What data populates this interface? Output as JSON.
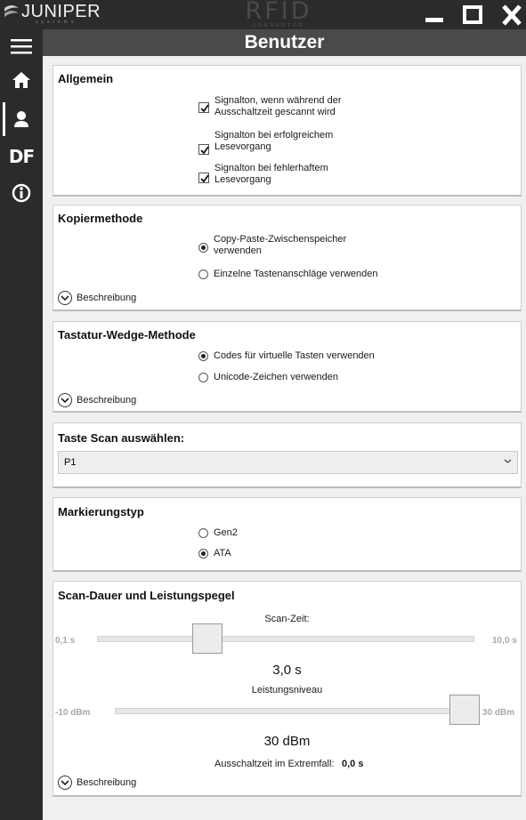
{
  "titlebar": {
    "brand": "JUNIPER",
    "brand_sub": "systems",
    "product": "RFID",
    "product_sub": "CONNECTOR"
  },
  "nav": {
    "items": [
      "menu-icon",
      "home-icon",
      "user-icon",
      "DF",
      "info-icon"
    ],
    "active": "user-icon",
    "df_label": "DF"
  },
  "header": {
    "title": "Benutzer"
  },
  "allgemein": {
    "title": "Allgemein",
    "options": [
      {
        "label": "Signalton, wenn während der Ausschaltzeit gescannt wird",
        "checked": true
      },
      {
        "label": "Signalton bei erfolgreichem Lesevorgang",
        "checked": true
      },
      {
        "label": "Signalton bei fehlerhaftem Lesevorgang",
        "checked": true
      }
    ]
  },
  "kopier": {
    "title": "Kopiermethode",
    "options": [
      {
        "label": "Copy-Paste-Zwischenspeicher verwenden",
        "selected": true
      },
      {
        "label": "Einzelne Tastenanschläge verwenden",
        "selected": false
      }
    ],
    "desc": "Beschreibung"
  },
  "wedge": {
    "title": "Tastatur-Wedge-Methode",
    "options": [
      {
        "label": "Codes für virtuelle Tasten verwenden",
        "selected": true
      },
      {
        "label": "Unicode-Zeichen verwenden",
        "selected": false
      }
    ],
    "desc": "Beschreibung"
  },
  "scan_key": {
    "title": "Taste Scan auswählen:",
    "selected": "P1"
  },
  "markierung": {
    "title": "Markierungstyp",
    "options": [
      {
        "label": "Gen2",
        "selected": false
      },
      {
        "label": "ATA",
        "selected": true
      }
    ]
  },
  "scan_power": {
    "title": "Scan-Dauer und Leistungspegel",
    "scan_time": {
      "label": "Scan-Zeit:",
      "min": "0,1 s",
      "max": "10,0 s",
      "value": "3,0 s",
      "fraction": 0.29
    },
    "power": {
      "label": "Leistungsniveau",
      "min": "-10 dBm",
      "max": "30 dBm",
      "value": "30 dBm",
      "fraction": 1.0
    },
    "worst_case_label": "Ausschaltzeit im Extremfall:",
    "worst_case_value": "0,0 s",
    "desc": "Beschreibung"
  },
  "colors": {
    "chrome": "#2b2b2b",
    "header": "#4a4a4a",
    "background": "#f0f0f0"
  }
}
